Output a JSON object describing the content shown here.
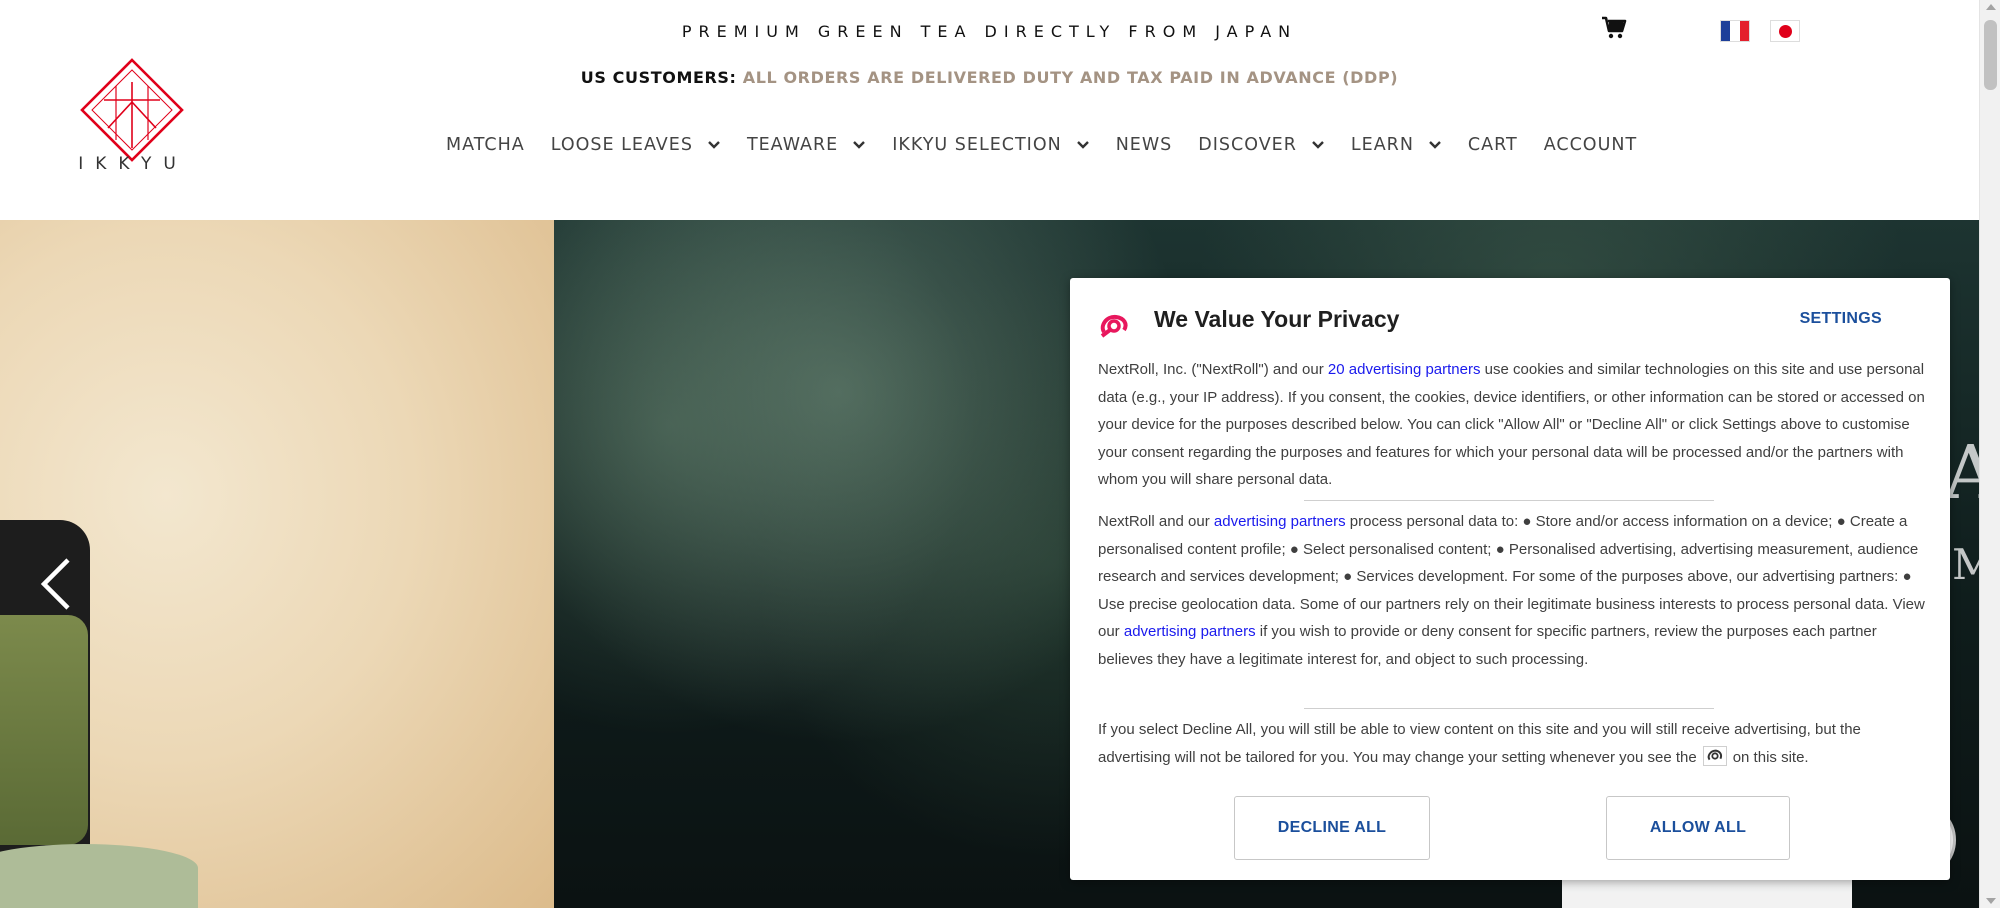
{
  "header": {
    "tagline": "PREMIUM GREEN TEA DIRECTLY FROM JAPAN",
    "notice_label": "US CUSTOMERS:",
    "notice_message": "ALL ORDERS ARE DELIVERED DUTY AND TAX PAID IN ADVANCE (DDP)",
    "logo_text": "IKKYU",
    "cart_icon": "cart-icon",
    "languages": [
      "French",
      "Japanese"
    ]
  },
  "nav": {
    "matcha": "MATCHA",
    "loose_leaves": "LOOSE LEAVES",
    "teaware": "TEAWARE",
    "ikkyu_selection": "IKKYU SELECTION",
    "news": "NEWS",
    "discover": "DISCOVER",
    "learn": "LEARN",
    "cart": "CART",
    "account": "ACCOUNT"
  },
  "hero": {
    "glyph_a": "A",
    "glyph_m": "M"
  },
  "consent": {
    "title": "We Value Your Privacy",
    "settings_label": "SETTINGS",
    "p1_a": "NextRoll, Inc. (\"NextRoll\") and our ",
    "p1_link": "20 advertising partners",
    "p1_b": " use cookies and similar technologies on this site and use personal data (e.g., your IP address). If you consent, the cookies, device identifiers, or other information can be stored or accessed on your device for the purposes described below. You can click \"Allow All\" or \"Decline All\" or click Settings above to customise your consent regarding the purposes and features for which your personal data will be processed and/or the partners with whom you will share personal data.",
    "p2_a": "NextRoll and our ",
    "p2_link1": "advertising partners",
    "p2_b": " process personal data to: ● Store and/or access information on a device; ● Create a personalised content profile; ● Select personalised content; ● Personalised advertising, advertising measurement, audience research and services development; ● Services development. For some of the purposes above, our advertising partners: ● Use precise geolocation data. Some of our partners rely on their legitimate business interests to process personal data. View our ",
    "p2_link2": "advertising partners",
    "p2_c": " if you wish to provide or deny consent for specific partners, review the purposes each partner believes they have a legitimate interest for, and object to such processing.",
    "p3_a": "If you select Decline All, you will still be able to view content on this site and you will still receive advertising, but the advertising will not be tailored for you. You may change your setting whenever you see the",
    "p3_b": "on this site.",
    "decline_label": "DECLINE ALL",
    "allow_label": "ALLOW ALL",
    "accent_color": "#1b4f9c",
    "link_color": "#1a1aed"
  },
  "colors": {
    "logo_red": "#e0001a",
    "notice_grey": "#a49383"
  }
}
